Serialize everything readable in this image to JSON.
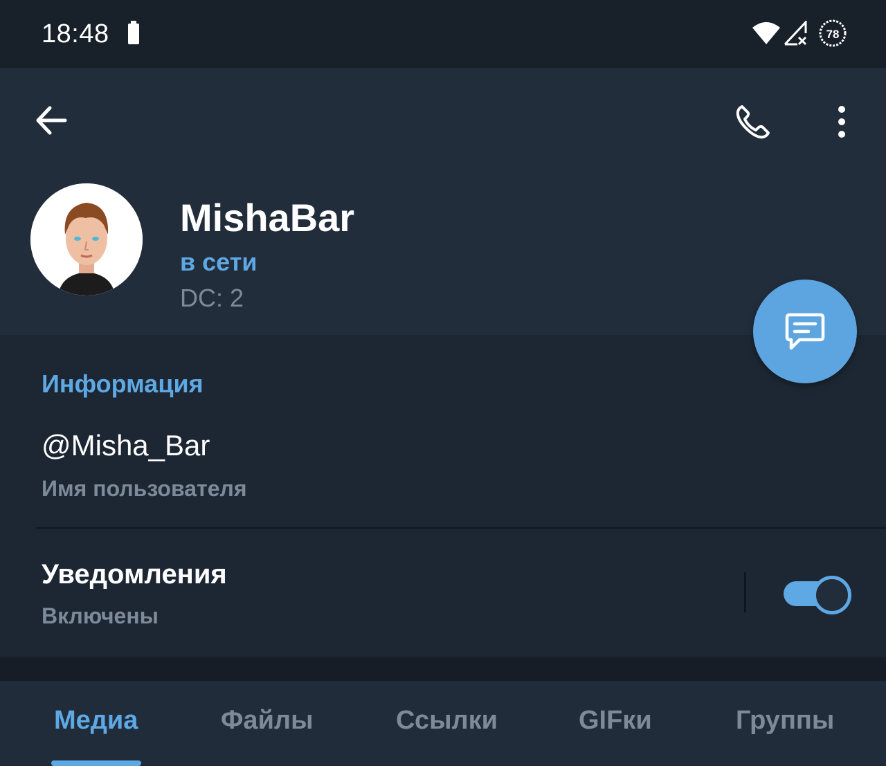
{
  "status_bar": {
    "time": "18:48",
    "battery_badge": "78"
  },
  "profile": {
    "name": "MishaBar",
    "status": "в сети",
    "dc": "DC: 2"
  },
  "info": {
    "section_title": "Информация",
    "username": "@Misha_Bar",
    "username_label": "Имя пользователя",
    "notifications_title": "Уведомления",
    "notifications_state": "Включены",
    "notifications_on": true
  },
  "tabs": [
    {
      "label": "Медиа",
      "active": true
    },
    {
      "label": "Файлы",
      "active": false
    },
    {
      "label": "Ссылки",
      "active": false
    },
    {
      "label": "GIFки",
      "active": false
    },
    {
      "label": "Группы",
      "active": false
    }
  ],
  "icons": {
    "back": "arrow-left-icon",
    "call": "phone-icon",
    "more": "more-vertical-icon",
    "fab": "message-icon"
  },
  "colors": {
    "accent": "#5ea8e4",
    "header_bg": "#222d3c",
    "body_bg": "#1d2733",
    "secondary_text": "#7d8b99"
  }
}
